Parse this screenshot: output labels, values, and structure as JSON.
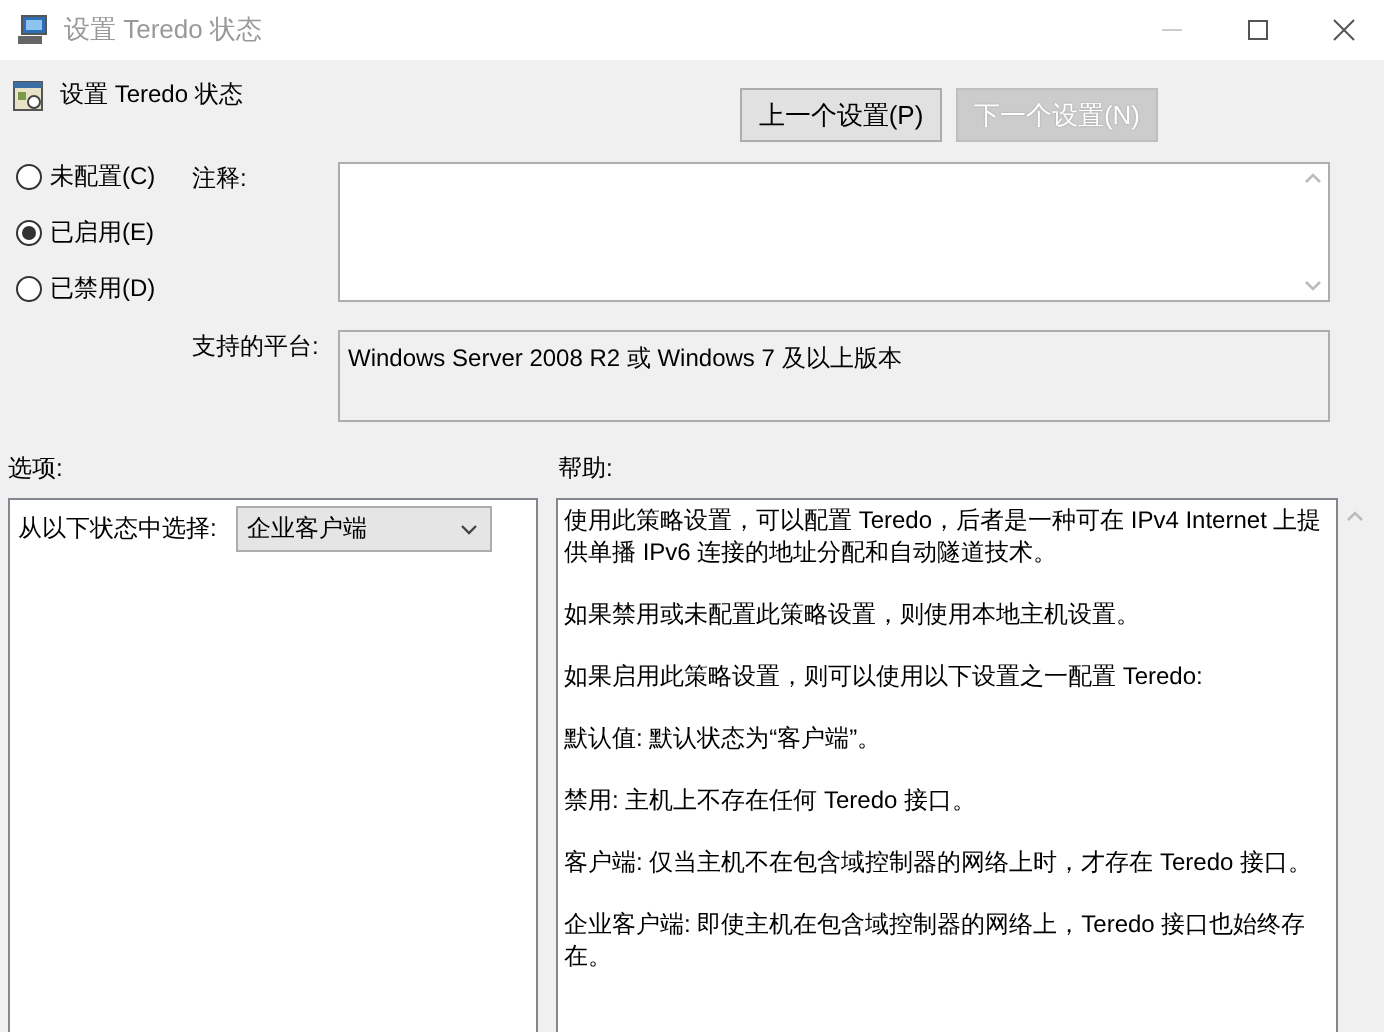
{
  "window": {
    "title": "设置 Teredo 状态"
  },
  "header": {
    "title": "设置 Teredo 状态",
    "buttons": [
      {
        "label": "上一个设置(P)",
        "disabled": false
      },
      {
        "label": "下一个设置(N)",
        "disabled": true
      }
    ]
  },
  "states": [
    {
      "label": "未配置(C)",
      "selected": false
    },
    {
      "label": "已启用(E)",
      "selected": true
    },
    {
      "label": "已禁用(D)",
      "selected": false
    }
  ],
  "comment": {
    "label": "注释:"
  },
  "platform": {
    "label": "支持的平台:",
    "value": "Windows Server 2008 R2 或 Windows 7 及以上版本"
  },
  "options": {
    "heading": "选项:",
    "prompt": "从以下状态中选择:",
    "value": "企业客户端"
  },
  "help": {
    "heading": "帮助:",
    "paragraphs": [
      "使用此策略设置，可以配置 Teredo，后者是一种可在 IPv4 Internet 上提供单播 IPv6 连接的地址分配和自动隧道技术。",
      "如果禁用或未配置此策略设置，则使用本地主机设置。",
      "如果启用此策略设置，则可以使用以下设置之一配置 Teredo:",
      "默认值: 默认状态为“客户端”。",
      "禁用: 主机上不存在任何 Teredo 接口。",
      "客户端: 仅当主机不在包含域控制器的网络上时，才存在 Teredo 接口。",
      "企业客户端: 即使主机在包含域控制器的网络上，Teredo 接口也始终存在。"
    ]
  }
}
